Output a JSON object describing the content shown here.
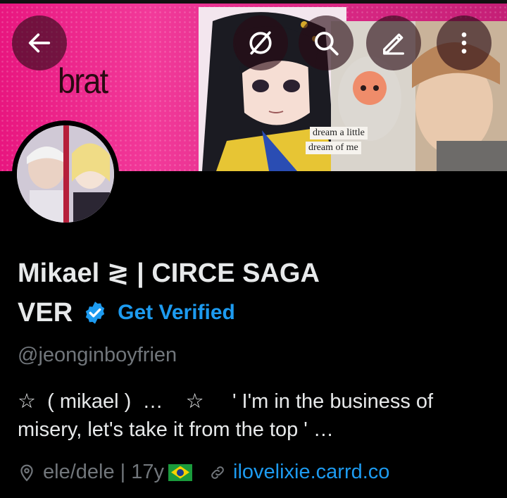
{
  "header": {
    "back_icon": "arrow-left-icon",
    "actions": [
      {
        "icon": "hide-eye-slash-icon"
      },
      {
        "icon": "search-icon"
      },
      {
        "icon": "edit-pencil-icon"
      },
      {
        "icon": "more-vertical-icon"
      }
    ]
  },
  "banner": {
    "brat_text": "brat",
    "note_line1": "dream a little",
    "note_line2": "dream of me"
  },
  "profile": {
    "name_line1": "Mikael ≷ | CIRCE SAGA",
    "name_line2": "VER",
    "get_verified": "Get Verified",
    "handle": "@jeonginboyfrien",
    "bio_line1": "☆  ( mikael )  …    ☆     ' I'm in the business of",
    "bio_line2": "misery, let's take it from the top ' …",
    "location": "ele/dele | 17y",
    "website": "ilovelixie.carrd.co"
  },
  "colors": {
    "accent": "#1d9bf0",
    "muted": "#71767b",
    "banner_pink": "#e8167f"
  }
}
